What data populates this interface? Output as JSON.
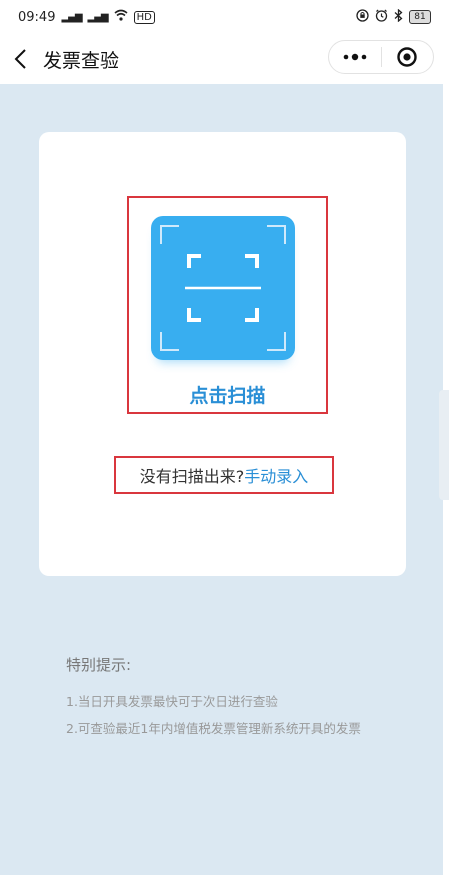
{
  "status_bar": {
    "time": "09:49",
    "signal1": "5G",
    "signal2": "5G",
    "hd": "HD",
    "battery": "81"
  },
  "title_bar": {
    "title": "发票查验",
    "more_icon": "more-dots-icon",
    "close_icon": "target-circle-icon"
  },
  "scan": {
    "label": "点击扫描",
    "icon": "scan-frame-icon",
    "tile_color": "#38aef0"
  },
  "manual": {
    "question": "没有扫描出来?",
    "link": "手动录入"
  },
  "tips": {
    "title": "特别提示:",
    "items": [
      "1.当日开具发票最快可于次日进行查验",
      "2.可查验最近1年内增值税发票管理新系统开具的发票"
    ]
  },
  "colors": {
    "background": "#dbe8f2",
    "accent": "#2a8fd6",
    "highlight_box": "#d9363e"
  }
}
